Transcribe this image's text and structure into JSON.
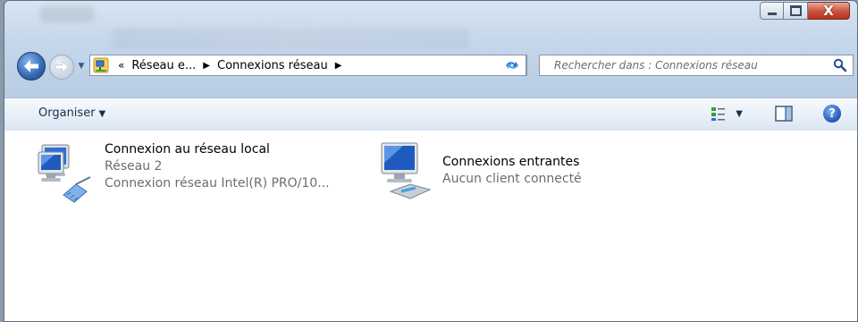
{
  "window": {
    "controls": {
      "minimize_icon": "minimize-icon",
      "maximize_icon": "maximize-icon",
      "close_label": "X"
    }
  },
  "navigation": {
    "breadcrumb": {
      "chevron": "«",
      "items": [
        "Réseau e...",
        "Connexions réseau"
      ]
    },
    "search": {
      "placeholder": "Rechercher dans : Connexions réseau"
    }
  },
  "toolbar": {
    "organize_label": "Organiser"
  },
  "connections": [
    {
      "name": "Connexion au réseau local",
      "line2": "Réseau  2",
      "line3": "Connexion réseau Intel(R) PRO/10..."
    },
    {
      "name": "Connexions entrantes",
      "line2": "Aucun client connecté"
    }
  ],
  "colors": {
    "accent": "#2f67b3",
    "close": "#c9503a",
    "secondary_text": "#6d6d6d"
  }
}
